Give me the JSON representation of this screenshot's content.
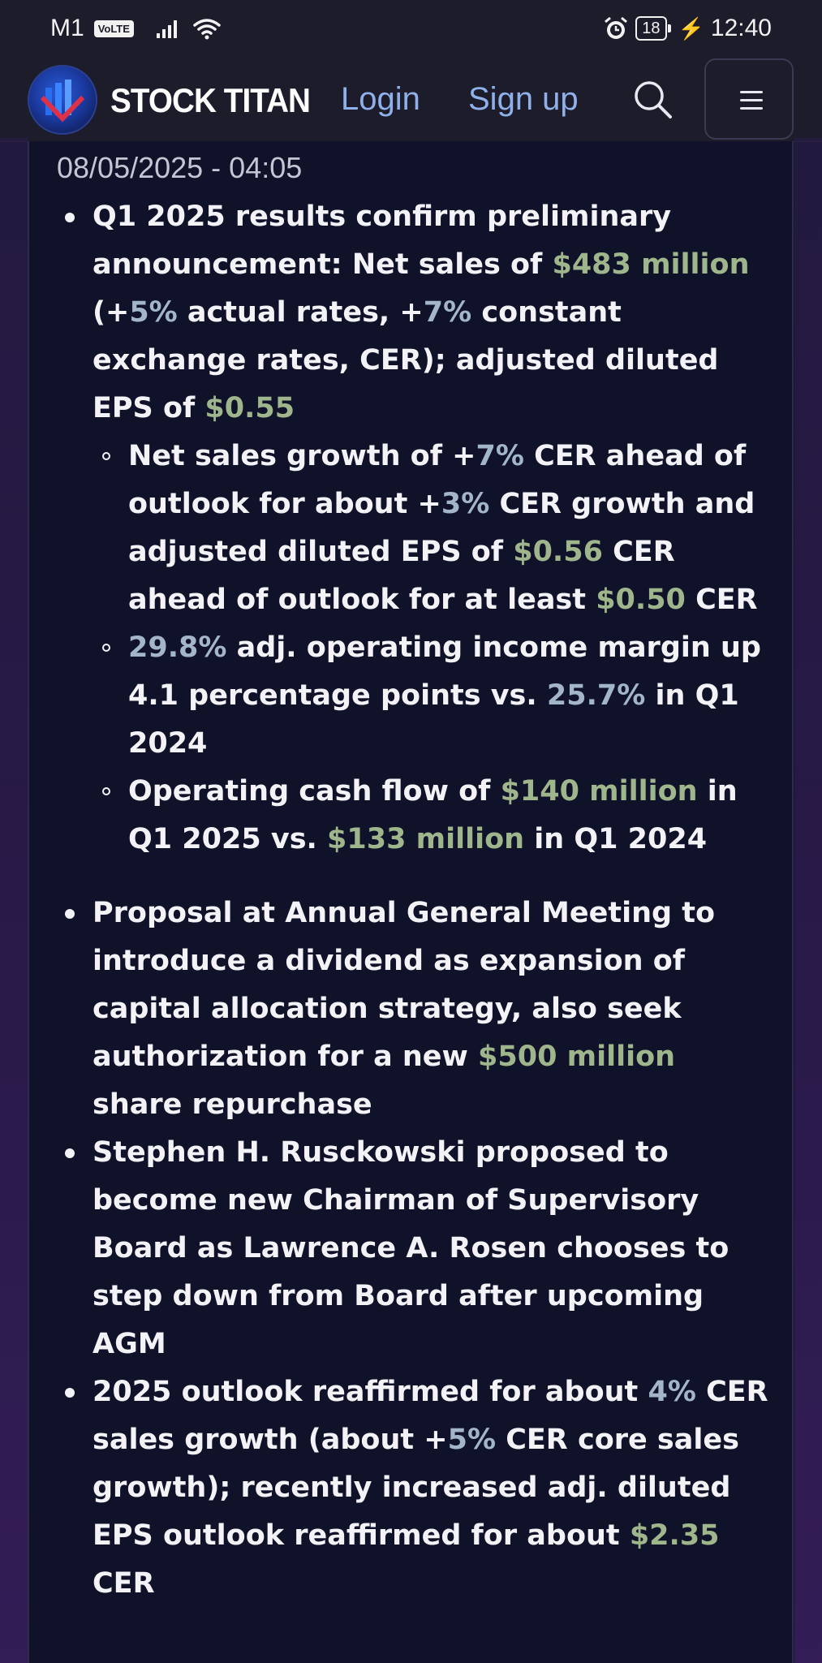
{
  "status_bar": {
    "carrier": "M1",
    "volte": "VoLTE",
    "battery": "18",
    "time": "12:40"
  },
  "header": {
    "brand": "STOCK TITAN",
    "login": "Login",
    "signup": "Sign up"
  },
  "article": {
    "dateline": "08/05/2025 - 04:05",
    "bullets": [
      {
        "segments": [
          {
            "t": "Q1 2025 results confirm preliminary announcement: Net sales of ",
            "k": "txt"
          },
          {
            "t": "$483 million",
            "k": "money"
          },
          {
            "t": " (+",
            "k": "txt"
          },
          {
            "t": "5%",
            "k": "pct"
          },
          {
            "t": " actual rates, +",
            "k": "txt"
          },
          {
            "t": "7%",
            "k": "pct"
          },
          {
            "t": " constant exchange rates, CER); adjusted diluted EPS of ",
            "k": "txt"
          },
          {
            "t": "$0.55",
            "k": "money"
          }
        ],
        "sub": [
          [
            {
              "t": "Net sales growth of +",
              "k": "txt"
            },
            {
              "t": "7%",
              "k": "pct"
            },
            {
              "t": " CER ahead of outlook for about +",
              "k": "txt"
            },
            {
              "t": "3%",
              "k": "pct"
            },
            {
              "t": " CER growth and adjusted diluted EPS of ",
              "k": "txt"
            },
            {
              "t": "$0.56",
              "k": "money"
            },
            {
              "t": " CER ahead of outlook for at least ",
              "k": "txt"
            },
            {
              "t": "$0.50",
              "k": "money"
            },
            {
              "t": " CER",
              "k": "txt"
            }
          ],
          [
            {
              "t": "29.8%",
              "k": "pct"
            },
            {
              "t": " adj. operating income margin up 4.1 percentage points vs. ",
              "k": "txt"
            },
            {
              "t": "25.7%",
              "k": "pct"
            },
            {
              "t": " in Q1 2024",
              "k": "txt"
            }
          ],
          [
            {
              "t": "Operating cash flow of ",
              "k": "txt"
            },
            {
              "t": "$140 million",
              "k": "money"
            },
            {
              "t": " in Q1 2025 vs. ",
              "k": "txt"
            },
            {
              "t": "$133 million",
              "k": "money"
            },
            {
              "t": " in Q1 2024",
              "k": "txt"
            }
          ]
        ]
      },
      {
        "gap_before": true,
        "segments": [
          {
            "t": "Proposal at Annual General Meeting to introduce a dividend as expansion of capital allocation strategy, also seek authorization for a new ",
            "k": "txt"
          },
          {
            "t": "$500 million",
            "k": "money"
          },
          {
            "t": " share repurchase",
            "k": "txt"
          }
        ],
        "sub": []
      },
      {
        "segments": [
          {
            "t": "Stephen H. Rusckowski proposed to become new Chairman of Supervisory Board as Lawrence A. Rosen chooses to step down from Board after upcoming AGM",
            "k": "txt"
          }
        ],
        "sub": []
      },
      {
        "segments": [
          {
            "t": "2025 outlook reaffirmed for about ",
            "k": "txt"
          },
          {
            "t": "4%",
            "k": "pct"
          },
          {
            "t": " CER sales growth (about +",
            "k": "txt"
          },
          {
            "t": "5%",
            "k": "pct"
          },
          {
            "t": " CER core sales growth); recently increased adj. diluted EPS outlook reaffirmed for about ",
            "k": "txt"
          },
          {
            "t": "$2.35",
            "k": "money"
          },
          {
            "t": " CER",
            "k": "txt"
          }
        ],
        "sub": []
      }
    ]
  }
}
